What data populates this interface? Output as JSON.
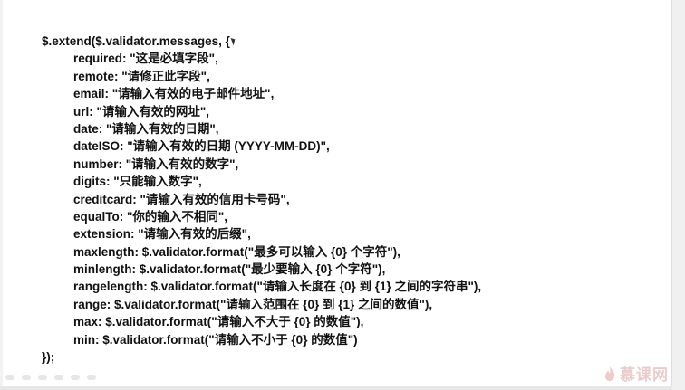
{
  "code": {
    "open_line": "$.extend($.validator.messages, {",
    "entries": [
      "required: \"这是必填字段\",",
      "remote: \"请修正此字段\",",
      "email: \"请输入有效的电子邮件地址\",",
      "url: \"请输入有效的网址\",",
      "date: \"请输入有效的日期\",",
      "dateISO: \"请输入有效的日期 (YYYY-MM-DD)\",",
      "number: \"请输入有效的数字\",",
      "digits: \"只能输入数字\",",
      "creditcard: \"请输入有效的信用卡号码\",",
      "equalTo: \"你的输入不相同\",",
      "extension: \"请输入有效的后缀\",",
      "maxlength: $.validator.format(\"最多可以输入 {0} 个字符\"),",
      "minlength: $.validator.format(\"最少要输入 {0} 个字符\"),",
      "rangelength: $.validator.format(\"请输入长度在 {0} 到 {1} 之间的字符串\"),",
      "range: $.validator.format(\"请输入范围在 {0} 到 {1} 之间的数值\"),",
      "max: $.validator.format(\"请输入不大于 {0} 的数值\"),",
      "min: $.validator.format(\"请输入不小于 {0} 的数值\")"
    ],
    "close_line": "});"
  },
  "watermark": {
    "text": "慕课网",
    "icon": "flame-icon",
    "color": "#d9a2a2"
  }
}
